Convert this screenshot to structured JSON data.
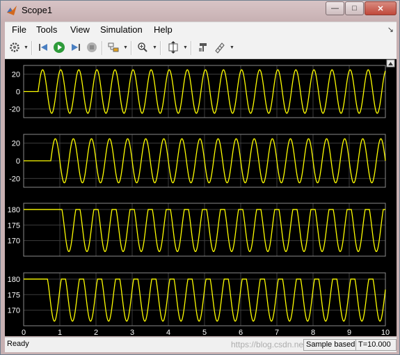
{
  "window": {
    "title": "Scope1"
  },
  "menu": {
    "items": [
      "File",
      "Tools",
      "View",
      "Simulation",
      "Help"
    ]
  },
  "toolbar": {
    "icons": [
      "gear-icon",
      "step-back-icon",
      "run-icon",
      "step-forward-icon",
      "stop-icon",
      "signal-select-icon",
      "zoom-icon",
      "autoscale-icon",
      "highlight-block-icon",
      "cursor-measure-icon"
    ]
  },
  "status": {
    "state": "Ready",
    "mode": "Sample based",
    "time": "T=10.000"
  },
  "watermark": "https://blog.csdn.net/...",
  "colors": {
    "trace": "#ffff00",
    "background": "#000000",
    "grid": "#3c3c3c",
    "axis_text": "#ffffff"
  },
  "chart_data": [
    {
      "type": "line",
      "title": "",
      "xlim": [
        0,
        10
      ],
      "ylim": [
        -30,
        30
      ],
      "yticks": [
        20,
        0,
        -20
      ],
      "series": [
        {
          "kind": "sine",
          "amplitude": 25,
          "offset": 0,
          "start": 0.4,
          "period": 0.5
        }
      ]
    },
    {
      "type": "line",
      "title": "",
      "xlim": [
        0,
        10
      ],
      "ylim": [
        -30,
        30
      ],
      "yticks": [
        20,
        0,
        -20
      ],
      "series": [
        {
          "kind": "sine",
          "amplitude": 25,
          "offset": 0,
          "start": 0.75,
          "period": 0.5
        }
      ]
    },
    {
      "type": "line",
      "title": "",
      "xlim": [
        0,
        10
      ],
      "ylim": [
        165,
        182
      ],
      "yticks": [
        180,
        175,
        170
      ],
      "series": [
        {
          "kind": "clipped",
          "high": 180,
          "low": 166.5,
          "start": 1.0,
          "period": 0.5
        }
      ]
    },
    {
      "type": "line",
      "title": "",
      "xlim": [
        0,
        10
      ],
      "ylim": [
        165,
        182
      ],
      "yticks": [
        180,
        175,
        170
      ],
      "series": [
        {
          "kind": "clipped",
          "high": 180,
          "low": 166.5,
          "start": 0.6,
          "period": 0.5
        }
      ]
    }
  ],
  "xaxis": {
    "ticks": [
      0,
      1,
      2,
      3,
      4,
      5,
      6,
      7,
      8,
      9,
      10
    ]
  }
}
